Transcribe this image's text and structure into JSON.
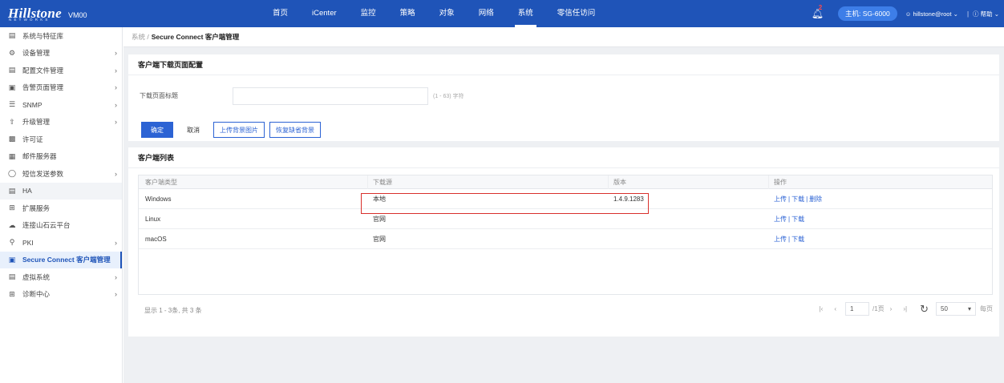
{
  "header": {
    "logo_text": "Hillstone",
    "logo_sub": "NETWORKS",
    "vm_label": "VM00",
    "nav": [
      "首页",
      "iCenter",
      "监控",
      "策略",
      "对象",
      "网络",
      "系统",
      "零信任访问"
    ],
    "active_nav": "系统",
    "bell_badge": "2",
    "host_label": "主机: SG-6000",
    "user_label": "hillstone@root",
    "help_label": "帮助"
  },
  "sidebar": {
    "items": [
      {
        "label": "系统与特征库",
        "icon": "database-icon",
        "chev": false
      },
      {
        "label": "设备管理",
        "icon": "device-icon",
        "chev": true
      },
      {
        "label": "配置文件管理",
        "icon": "config-file-icon",
        "chev": true
      },
      {
        "label": "告警页面管理",
        "icon": "alarm-page-icon",
        "chev": true
      },
      {
        "label": "SNMP",
        "icon": "snmp-icon",
        "chev": true
      },
      {
        "label": "升级管理",
        "icon": "upgrade-icon",
        "chev": true
      },
      {
        "label": "许可证",
        "icon": "license-icon",
        "chev": false
      },
      {
        "label": "邮件服务器",
        "icon": "mail-server-icon",
        "chev": false
      },
      {
        "label": "短信发送参数",
        "icon": "sms-icon",
        "chev": true
      },
      {
        "label": "HA",
        "icon": "ha-icon",
        "chev": false
      },
      {
        "label": "扩展服务",
        "icon": "extension-icon",
        "chev": false
      },
      {
        "label": "连接山石云平台",
        "icon": "cloud-icon",
        "chev": false
      },
      {
        "label": "PKI",
        "icon": "key-icon",
        "chev": true
      },
      {
        "label": "Secure Connect 客户端管理",
        "icon": "secure-connect-icon",
        "chev": false
      },
      {
        "label": "虚拟系统",
        "icon": "virtual-system-icon",
        "chev": true
      },
      {
        "label": "诊断中心",
        "icon": "diagnosis-icon",
        "chev": true
      }
    ]
  },
  "breadcrumb": {
    "parent": "系统 /",
    "current": "Secure Connect 客户端管理"
  },
  "download_config": {
    "title": "客户端下载页面配置",
    "field_label": "下载页面标题",
    "field_value": "",
    "field_hint": "(1 - 63) 字符",
    "btn_ok": "确定",
    "btn_cancel": "取消",
    "btn_upload_bg": "上传背景图片",
    "btn_restore_bg": "恢复缺省背景"
  },
  "client_list": {
    "title": "客户端列表",
    "columns": [
      "客户端类型",
      "下载源",
      "版本",
      "操作"
    ],
    "rows": [
      {
        "type": "Windows",
        "source": "本地",
        "version": "1.4.9.1283",
        "actions": [
          "上传",
          "下载",
          "删除"
        ]
      },
      {
        "type": "Linux",
        "source": "官网",
        "version": "",
        "actions": [
          "上传",
          "下载"
        ]
      },
      {
        "type": "macOS",
        "source": "官网",
        "version": "",
        "actions": [
          "上传",
          "下载"
        ]
      }
    ],
    "footer_count": "显示 1 - 3条, 共 3 条",
    "pager": {
      "page_value": "1",
      "page_total": "/1页",
      "page_size": "50",
      "per_page_label": "每页"
    }
  }
}
